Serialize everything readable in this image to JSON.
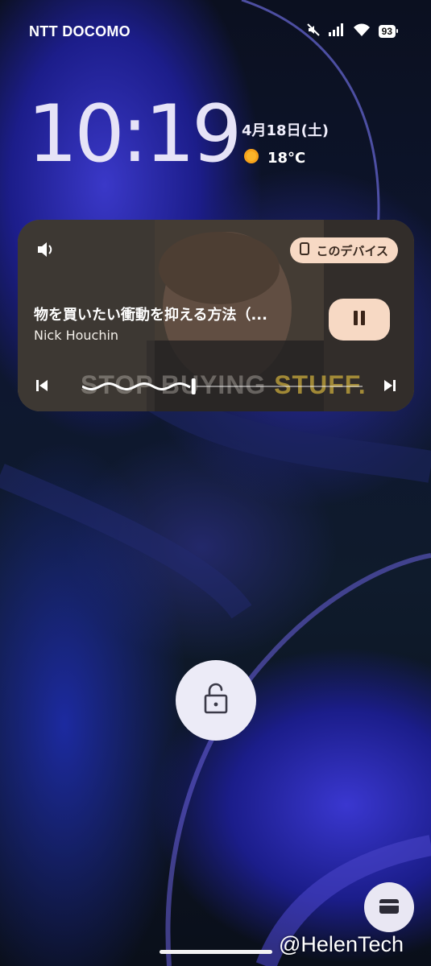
{
  "status_bar": {
    "carrier": "NTT DOCOMO",
    "icons": [
      "mute-icon",
      "signal-icon",
      "wifi-icon"
    ],
    "battery_level": "93"
  },
  "lock_screen": {
    "time": "10:19",
    "date": "4月18日(土)",
    "weather": {
      "icon": "sun-icon",
      "temperature": "18°C"
    }
  },
  "media_player": {
    "output_device_label": "このデバイス",
    "track_title": "物を買いたい衝動を抑える方法（...",
    "artist": "Nick Houchin",
    "artwork_text_1": "STOP BUYING ",
    "artwork_text_2": "STUFF.",
    "progress": 0.39,
    "accent_color": "#f7d9c4"
  },
  "watermark": "@HelenTech"
}
